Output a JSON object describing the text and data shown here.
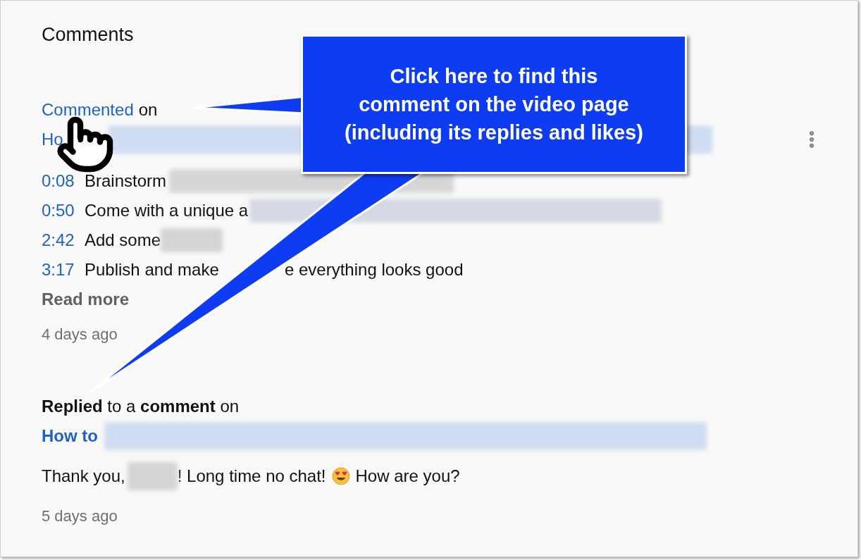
{
  "section_title": "Comments",
  "callout": {
    "lines": [
      "Click here to find this",
      "comment on the video page",
      "(including its replies and likes)"
    ]
  },
  "activities": [
    {
      "kind": "commented",
      "action_link": "Commented",
      "action_rest": "on",
      "video_title": "Ho",
      "timestamps": [
        {
          "time": "0:08",
          "text": "Brainstorm"
        },
        {
          "time": "0:50",
          "text": "Come with a unique a"
        },
        {
          "time": "2:42",
          "text": "Add some"
        },
        {
          "time": "3:17",
          "text": "Publish and make",
          "text_after": "e everything looks good"
        }
      ],
      "read_more": "Read more",
      "age": "4 days ago"
    },
    {
      "kind": "replied",
      "action": "**Replied** to a **comment** on",
      "video_title": "How to",
      "reply_before": "Thank you,",
      "reply_after": "! Long time no chat!",
      "reply_end": "How are you?",
      "age": "5 days ago"
    }
  ]
}
